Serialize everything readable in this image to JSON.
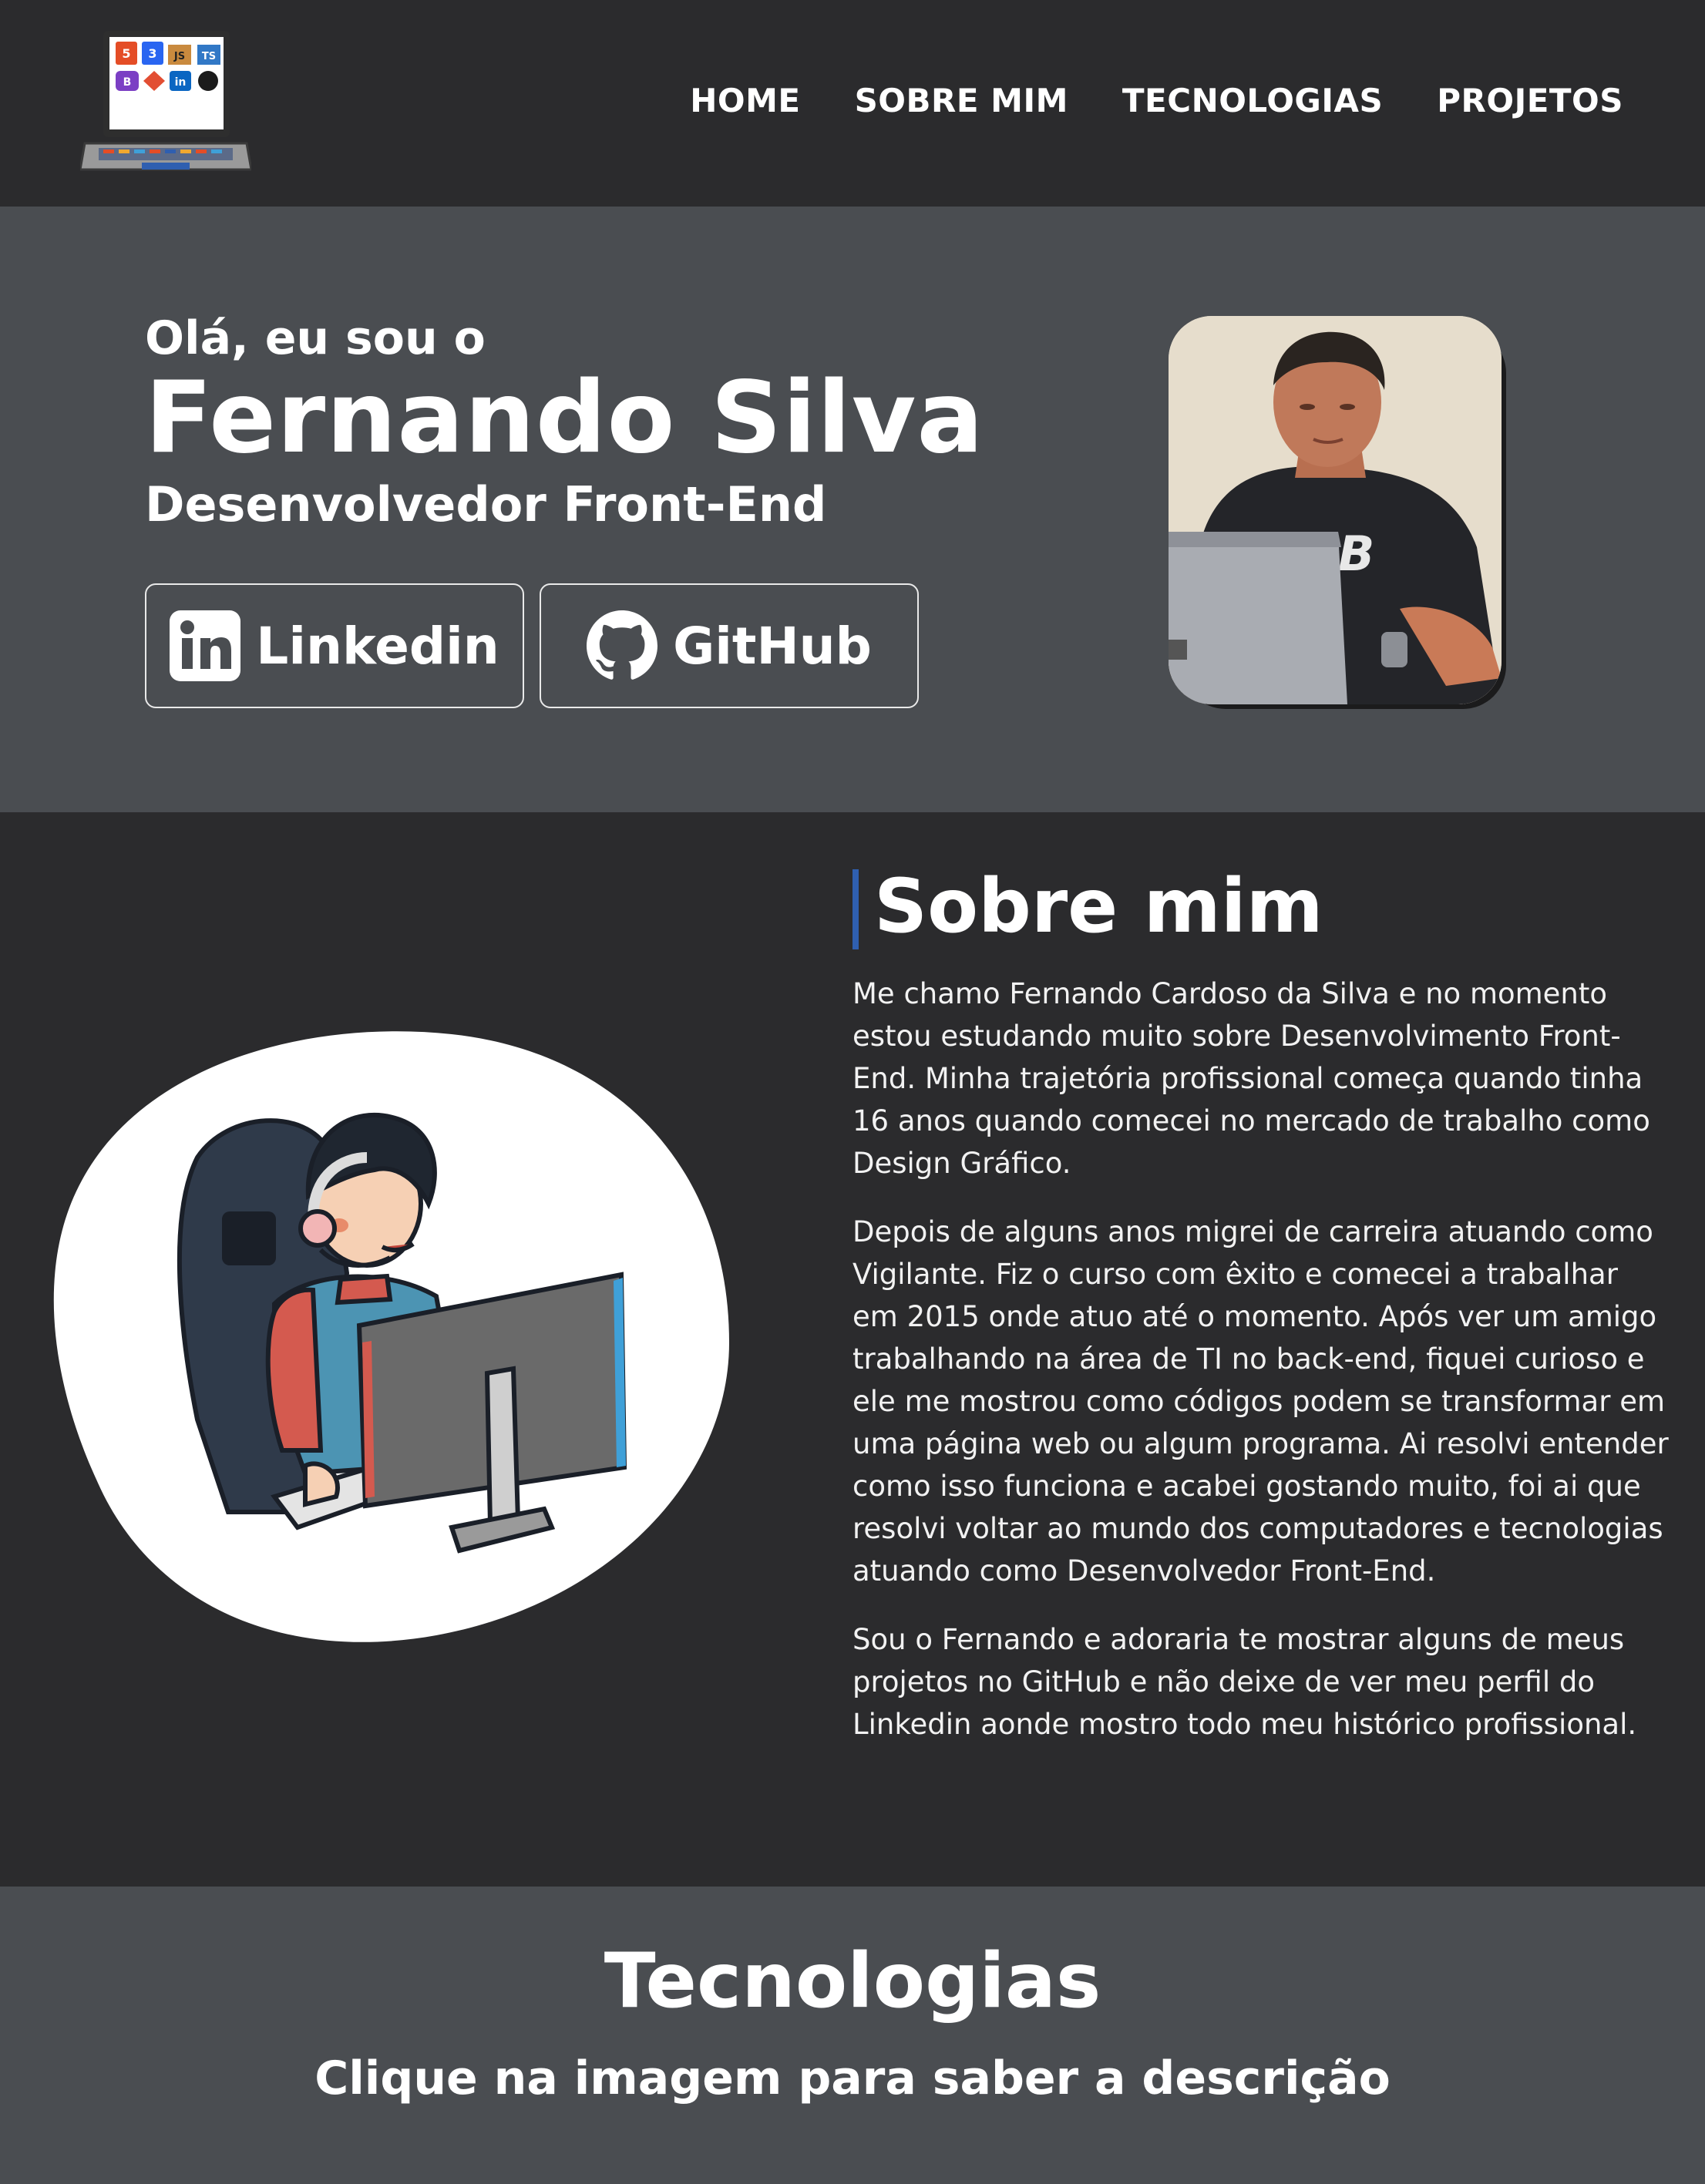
{
  "nav": {
    "logo_badges": [
      "5",
      "3",
      "JS",
      "TS",
      "B",
      "in"
    ],
    "items": [
      {
        "label": "HOME"
      },
      {
        "label": "SOBRE MIM"
      },
      {
        "label": "TECNOLOGIAS"
      },
      {
        "label": "PROJETOS"
      }
    ]
  },
  "hero": {
    "greeting": "Olá, eu sou o",
    "name": "Fernando Silva",
    "role": "Desenvolvedor Front-End",
    "linkedin_label": "Linkedin",
    "github_label": "GitHub"
  },
  "about": {
    "title": "Sobre mim",
    "paragraphs": [
      "Me chamo Fernando Cardoso da Silva e no momento estou estudando muito sobre Desenvolvimento Front-End. Minha trajetória profissional começa quando tinha 16 anos quando comecei no mercado de trabalho como Design Gráfico.",
      "Depois de alguns anos migrei de carreira atuando como Vigilante. Fiz o curso com êxito e comecei a trabalhar em 2015 onde atuo até o momento. Após ver um amigo trabalhando na área de TI no back-end, fiquei curioso e ele me mostrou como códigos podem se transformar em uma página web ou algum programa. Ai resolvi entender como isso funciona e acabei gostando muito, foi ai que resolvi voltar ao mundo dos computadores e tecnologias atuando como Desenvolvedor Front-End.",
      "Sou o Fernando e adoraria te mostrar alguns de meus projetos no GitHub e não deixe de ver meu perfil do Linkedin aonde mostro todo meu histórico profissional."
    ]
  },
  "tech": {
    "title": "Tecnologias",
    "subtitle": "Clique na imagem para saber a descrição"
  },
  "colors": {
    "nav_bg": "#2b2b2d",
    "hero_bg": "#4a4d51",
    "accent": "#2f5fb0"
  }
}
